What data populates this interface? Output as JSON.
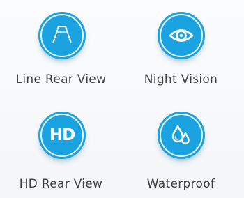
{
  "features": [
    {
      "label": "Line Rear View",
      "icon": "rear-view-lines-icon"
    },
    {
      "label": "Night Vision",
      "icon": "eye-icon"
    },
    {
      "label": "HD Rear View",
      "icon": "hd-icon",
      "icon_text": "HD"
    },
    {
      "label": "Waterproof",
      "icon": "water-drops-icon"
    }
  ],
  "colors": {
    "badge_fill": "#1aa3e0",
    "label_text": "#3a3f45",
    "icon_stroke": "#ffffff"
  }
}
